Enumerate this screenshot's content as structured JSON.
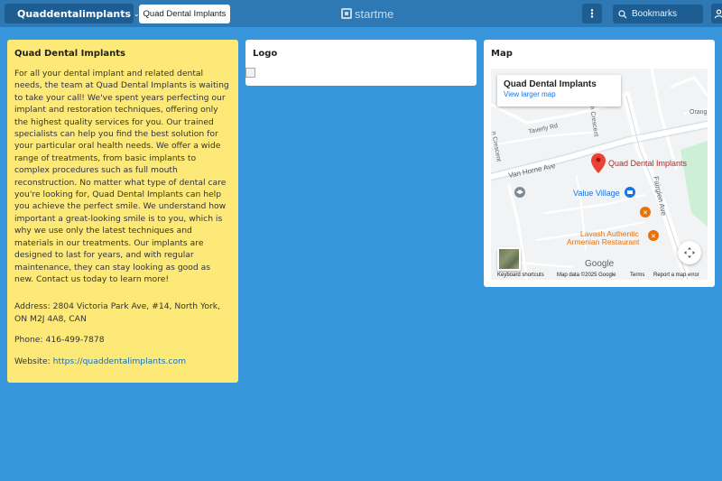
{
  "topbar": {
    "user_label": "Quaddentalimplants",
    "active_page": "Quad Dental Implants",
    "brand": "startme",
    "search_label": "Bookmarks"
  },
  "info_widget": {
    "title": "Quad Dental Implants",
    "description": "For all your dental implant and related dental needs, the team at Quad Dental Implants is waiting to take your call! We've spent years perfecting our implant and restoration techniques, offering only the highest quality services for you. Our trained specialists can help you find the best solution for your particular oral health needs. We offer a wide range of treatments, from basic implants to complex procedures such as full mouth reconstruction. No matter what type of dental care you're looking for, Quad Dental Implants can help you achieve the perfect smile. We understand how important a great-looking smile is to you, which is why we use only the latest techniques and materials in our treatments. Our implants are designed to last for years, and with regular maintenance, they can stay looking as good as new. Contact us today to learn more!",
    "address": "Address: 2804 Victoria Park Ave, #14, North York, ON M2J 4A8, CAN",
    "phone": "Phone: 416-499-7878",
    "website_prefix": "Website: ",
    "website_url": "https://quaddentalimplants.com"
  },
  "logo_widget": {
    "title": "Logo"
  },
  "map_widget": {
    "title": "Map",
    "card_title": "Quad Dental Implants",
    "card_link": "View larger map",
    "place_label": "Quad Dental Implants",
    "street_labels": [
      "Taverly Rd",
      "Van Horne Ave",
      "Fairglen Ave",
      "n Crescent",
      "n Crescent",
      "Orang"
    ],
    "poi_labels": [
      "Value Village",
      "Lavash Authentic",
      "Armenian Restaurant"
    ],
    "google_logo": "Google",
    "footer": {
      "shortcuts": "Keyboard shortcuts",
      "map_data": "Map data ©2025 Google",
      "terms": "Terms",
      "report": "Report a map error"
    },
    "colors": {
      "pin": "#ea4335",
      "place_text": "#c5221f",
      "poi_blue": "#1a73e8",
      "poi_orange": "#e8710a"
    }
  }
}
